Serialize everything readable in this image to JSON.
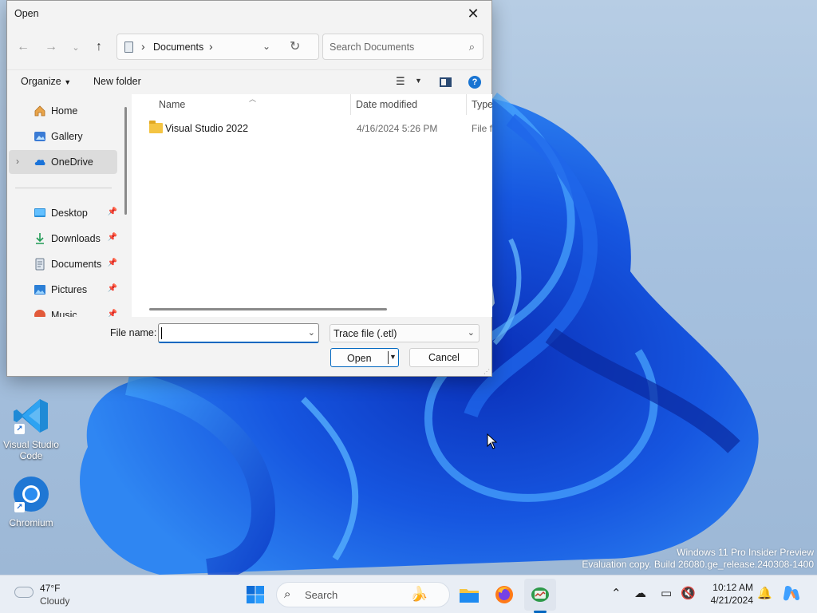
{
  "dialog": {
    "title": "Open",
    "address": {
      "path": "Documents"
    },
    "search": {
      "placeholder": "Search Documents"
    },
    "toolbar": {
      "organize": "Organize",
      "new_folder": "New folder",
      "help": "?"
    },
    "nav_pane": {
      "items": [
        {
          "label": "Home",
          "icon": "home-icon"
        },
        {
          "label": "Gallery",
          "icon": "gallery-icon"
        },
        {
          "label": "OneDrive",
          "icon": "cloud-icon",
          "selected": true
        },
        {
          "label": "Desktop",
          "icon": "desktop-icon",
          "pinned": true
        },
        {
          "label": "Downloads",
          "icon": "download-icon",
          "pinned": true
        },
        {
          "label": "Documents",
          "icon": "documents-icon",
          "pinned": true
        },
        {
          "label": "Pictures",
          "icon": "pictures-icon",
          "pinned": true
        },
        {
          "label": "Music",
          "icon": "music-icon",
          "pinned": true
        }
      ]
    },
    "columns": {
      "name": "Name",
      "date": "Date modified",
      "type": "Type"
    },
    "files": [
      {
        "name": "Visual Studio 2022",
        "date": "4/16/2024 5:26 PM",
        "type": "File folder"
      }
    ],
    "file_name": {
      "label": "File name:",
      "value": ""
    },
    "filter": {
      "selected": "Trace file (.etl)"
    },
    "buttons": {
      "open": "Open",
      "cancel": "Cancel"
    }
  },
  "desktop": {
    "icons": [
      {
        "label": "Visual Studio Code",
        "icon": "vscode-icon"
      },
      {
        "label": "Chromium",
        "icon": "chromium-icon"
      }
    ],
    "watermark": {
      "line1": "Windows 11 Pro Insider Preview",
      "line2": "Evaluation copy. Build 26080.ge_release.240308-1400"
    }
  },
  "taskbar": {
    "weather": {
      "temp": "47°F",
      "condition": "Cloudy"
    },
    "search_placeholder": "Search",
    "clock": {
      "time": "10:12 AM",
      "date": "4/21/2024"
    },
    "colors": {
      "accent": "#0067c0"
    }
  }
}
